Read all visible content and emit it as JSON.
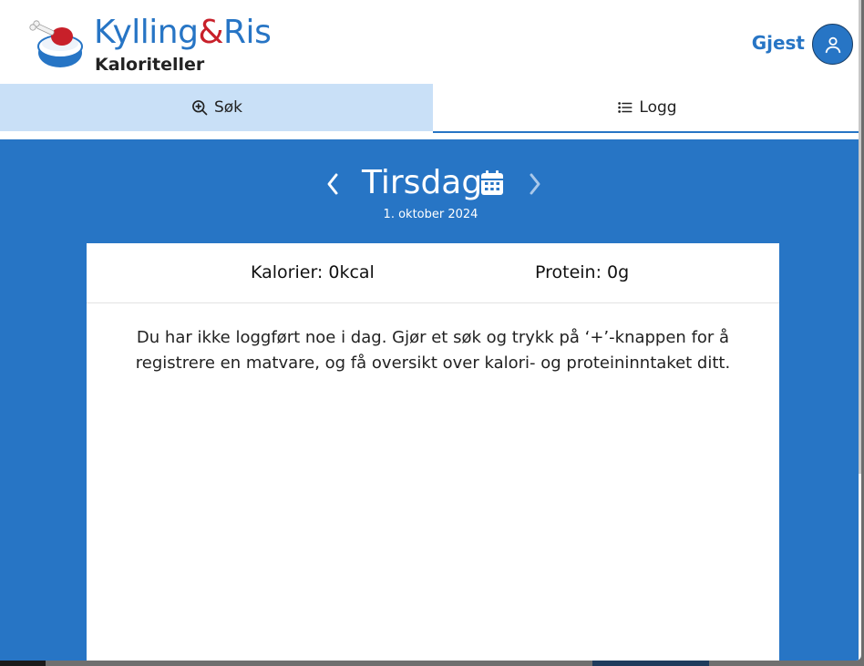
{
  "header": {
    "brand_part1": "Kylling",
    "brand_amp": "&",
    "brand_part2": "Ris",
    "subtitle": "Kaloriteller",
    "user_label": "Gjest"
  },
  "tabs": [
    {
      "label": "Søk",
      "icon": "zoom-in-icon",
      "active": true
    },
    {
      "label": "Logg",
      "icon": "list-icon",
      "active": false
    }
  ],
  "day": {
    "weekday": "Tirsdag",
    "date": "1. oktober 2024"
  },
  "totals": {
    "calories_label": "Kalorier: 0kcal",
    "protein_label": "Protein: 0g"
  },
  "empty_message": "Du har ikke loggført noe i dag. Gjør et søk og trykk på ‘+’-knappen for å registrere en matvare, og få oversikt over kalori- og proteininntaket ditt.",
  "colors": {
    "primary": "#2775c5",
    "accent_red": "#c8202a",
    "active_tab_bg": "#c9e0f7"
  }
}
